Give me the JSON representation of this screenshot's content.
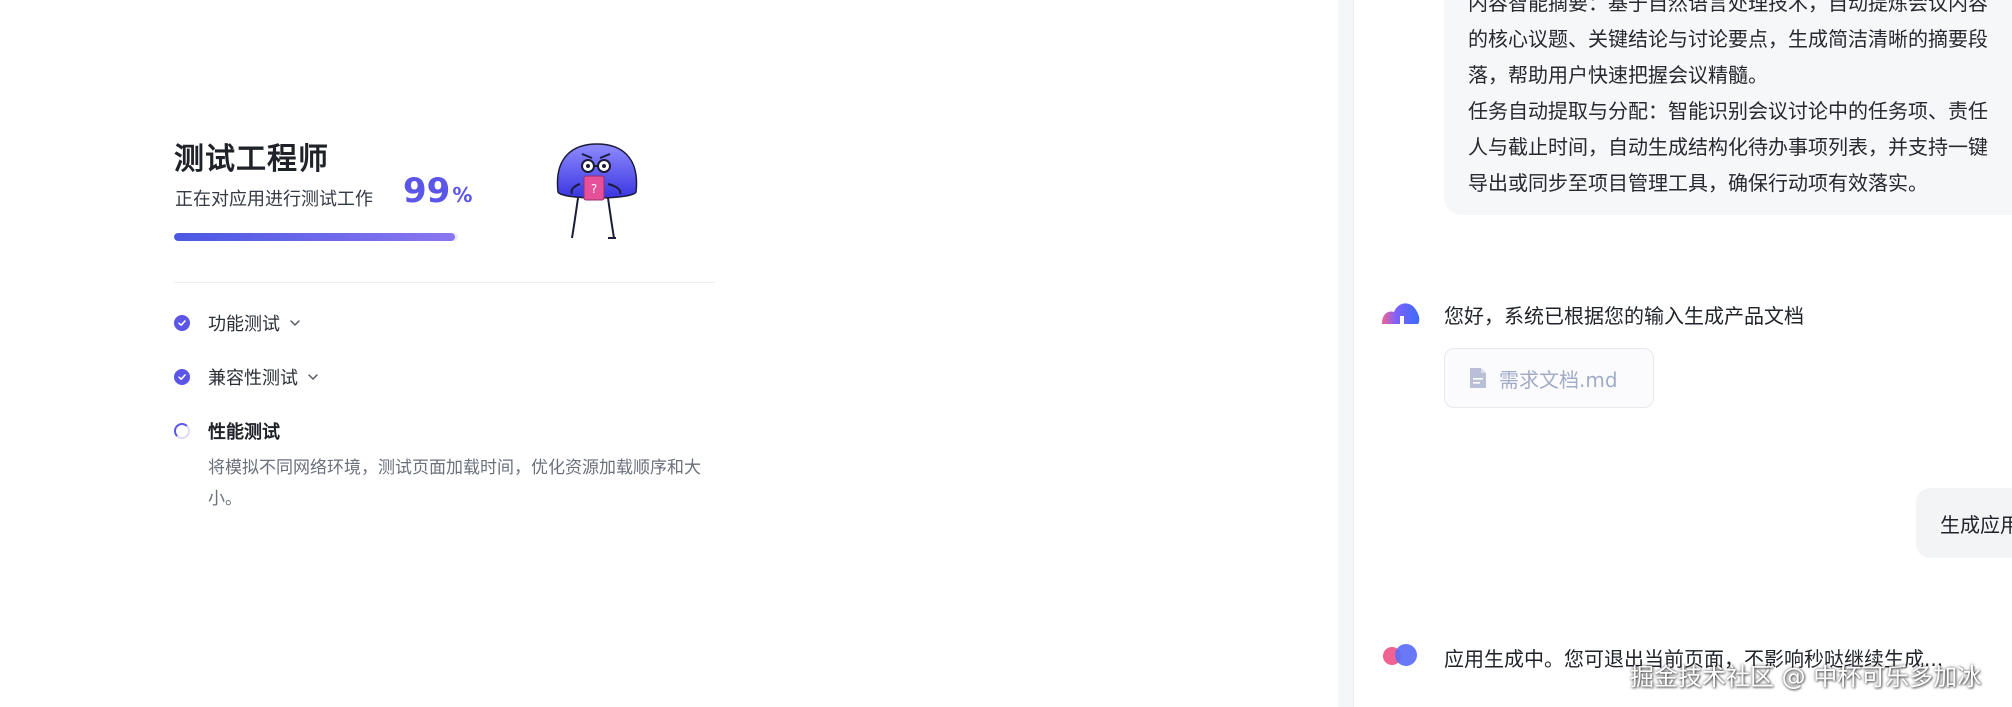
{
  "colors": {
    "accent": "#5b55e8",
    "progress_start": "#4b58e4",
    "progress_end": "#8a77f0",
    "divider": "#f5f6f8",
    "bubble_bg": "#f6f7f9",
    "muted_text": "#6a707c",
    "file_text": "#a3acc7"
  },
  "test_panel": {
    "title": "测试工程师",
    "subtitle": "正在对应用进行测试工作",
    "progress_value": "99",
    "progress_unit": "%",
    "progress_fraction": 0.99,
    "mascot_icon": "mushroom-mascot-icon",
    "tasks": [
      {
        "label": "功能测试",
        "status": "done",
        "expandable": true
      },
      {
        "label": "兼容性测试",
        "status": "done",
        "expandable": true
      },
      {
        "label": "性能测试",
        "status": "in-progress",
        "expandable": false,
        "description": "将模拟不同网络环境，测试页面加载时间，优化资源加载顺序和大小。"
      }
    ]
  },
  "chat": {
    "previous_message_lines": [
      "内容智能摘要：基于自然语言处理技术，自动提炼会议内容",
      "的核心议题、关键结论与讨论要点，生成简洁清晰的摘要段",
      "落，帮助用户快速把握会议精髓。",
      "任务自动提取与分配：智能识别会议讨论中的任务项、责任",
      "人与截止时间，自动生成结构化待办事项列表，并支持一键",
      "导出或同步至项目管理工具，确保行动项有效落实。"
    ],
    "bot_message_1": "您好，系统已根据您的输入生成产品文档",
    "attachment": {
      "icon": "document-icon",
      "name": "需求文档.md"
    },
    "user_message": "生成应用",
    "bot_message_2": "应用生成中。您可退出当前页面，不影响秒哒继续生成..."
  },
  "watermark": "掘金技术社区 @ 中杯可乐多加冰"
}
